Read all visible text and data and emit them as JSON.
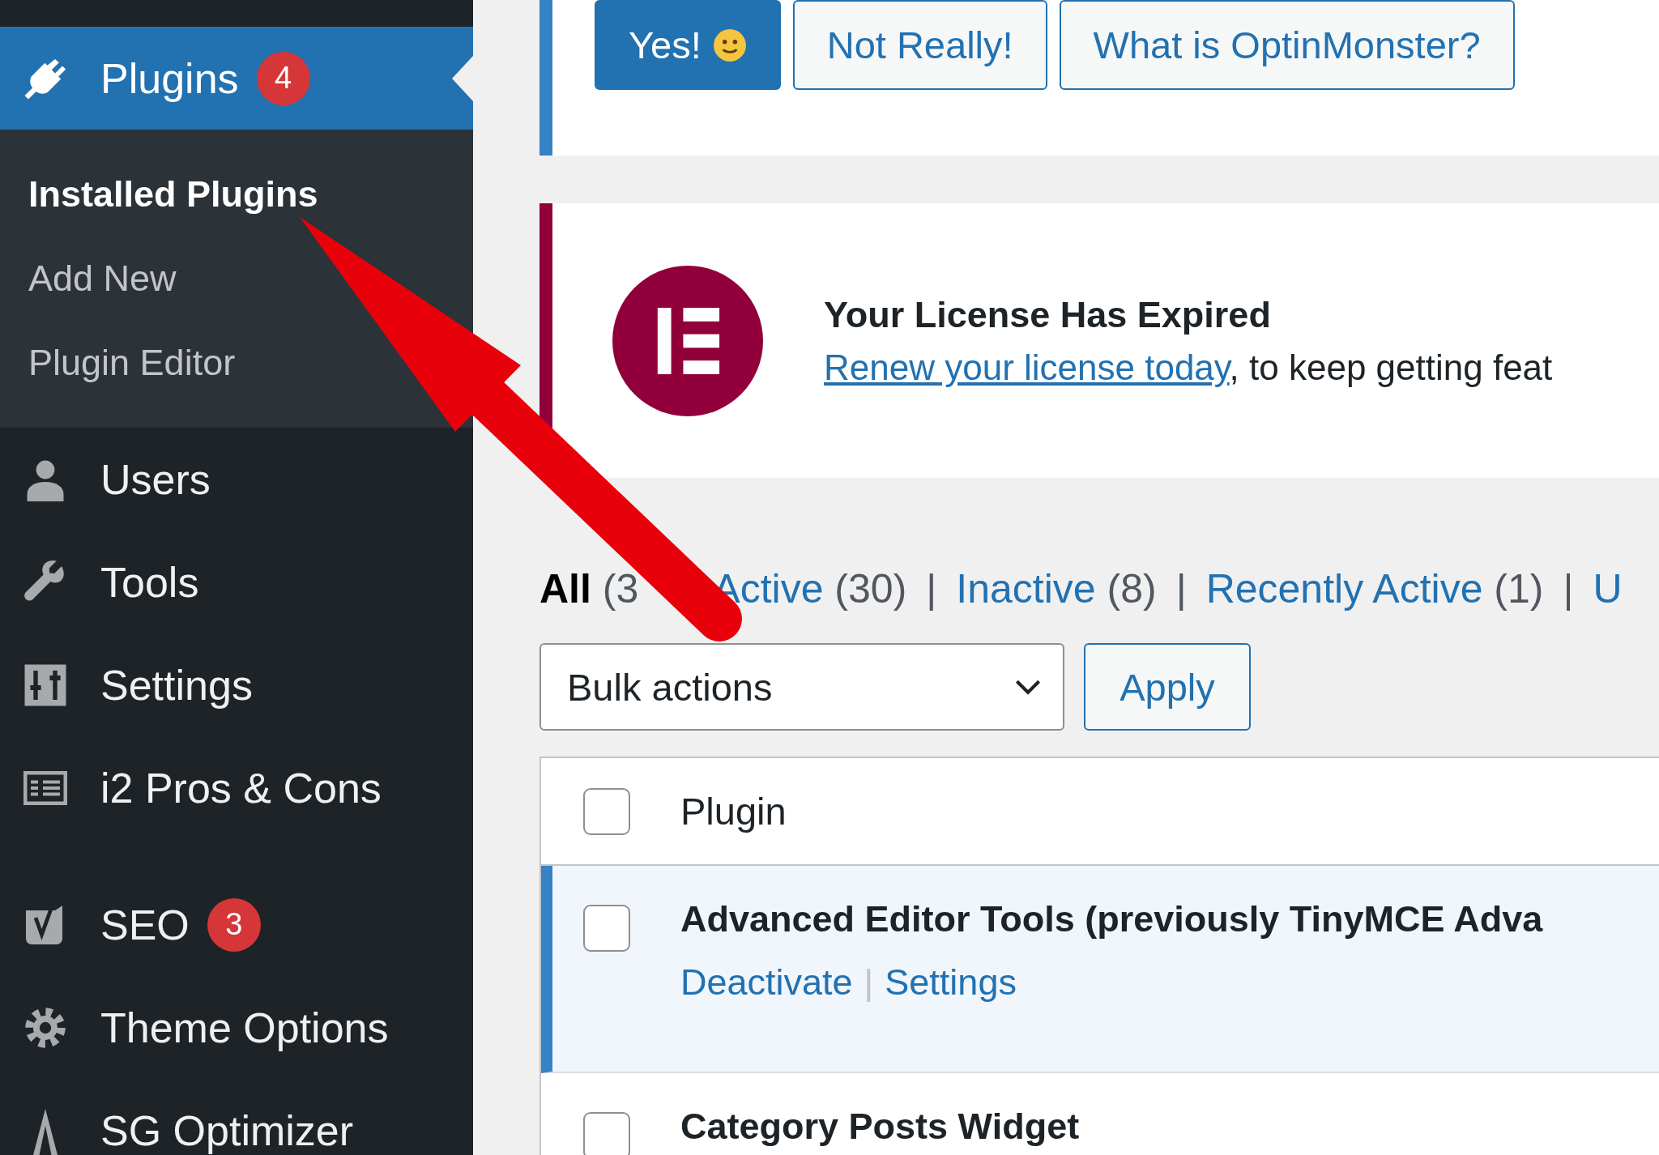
{
  "sidebar": {
    "menu_groups": [
      {
        "items": [
          {
            "label": "Plugins",
            "badge": "4",
            "selected": true,
            "children": [
              {
                "label": "Installed Plugins",
                "selected": true
              },
              {
                "label": "Add New",
                "selected": false
              },
              {
                "label": "Plugin Editor",
                "selected": false
              }
            ]
          },
          {
            "label": "Users",
            "selected": false
          },
          {
            "label": "Tools",
            "selected": false
          },
          {
            "label": "Settings",
            "selected": false
          },
          {
            "label": "i2 Pros & Cons",
            "selected": false
          }
        ]
      },
      {
        "items": [
          {
            "label": "SEO",
            "badge": "3",
            "selected": false
          },
          {
            "label": "Theme Options",
            "selected": false
          },
          {
            "label": "SG Optimizer",
            "selected": false
          }
        ]
      }
    ]
  },
  "optin_notice": {
    "buttons": [
      {
        "label": "Yes!",
        "kind": "primary"
      },
      {
        "label": "Not Really!",
        "kind": "secondary"
      },
      {
        "label": "What is OptinMonster?",
        "kind": "secondary"
      }
    ]
  },
  "license_notice": {
    "title": "Your License Has Expired",
    "link": "Renew your license today",
    "text": ", to keep getting feat"
  },
  "filters": [
    {
      "label": "All",
      "count": "(3",
      "selected": true
    },
    {
      "label": "Active",
      "count": "(30)",
      "selected": false
    },
    {
      "separator": "|",
      "label": "Inactive",
      "count": "(8)",
      "selected": false
    },
    {
      "separator": "|",
      "label": "Recently Active",
      "count": "(1)",
      "selected": false
    },
    {
      "separator": "|",
      "label": "U",
      "selected": false
    }
  ],
  "bulk_actions": {
    "value": "Bulk actions",
    "apply": "Apply"
  },
  "table": {
    "columns": [
      "Plugin"
    ],
    "header_checked": false,
    "rows": [
      {
        "name": "Advanced Editor Tools (previously TinyMCE Adva",
        "active": true,
        "checked": false,
        "actions": [
          {
            "label": "Deactivate"
          },
          {
            "separator": "|",
            "label": "Settings"
          }
        ]
      },
      {
        "name": "Category Posts Widget",
        "active": false,
        "checked": false
      }
    ]
  }
}
